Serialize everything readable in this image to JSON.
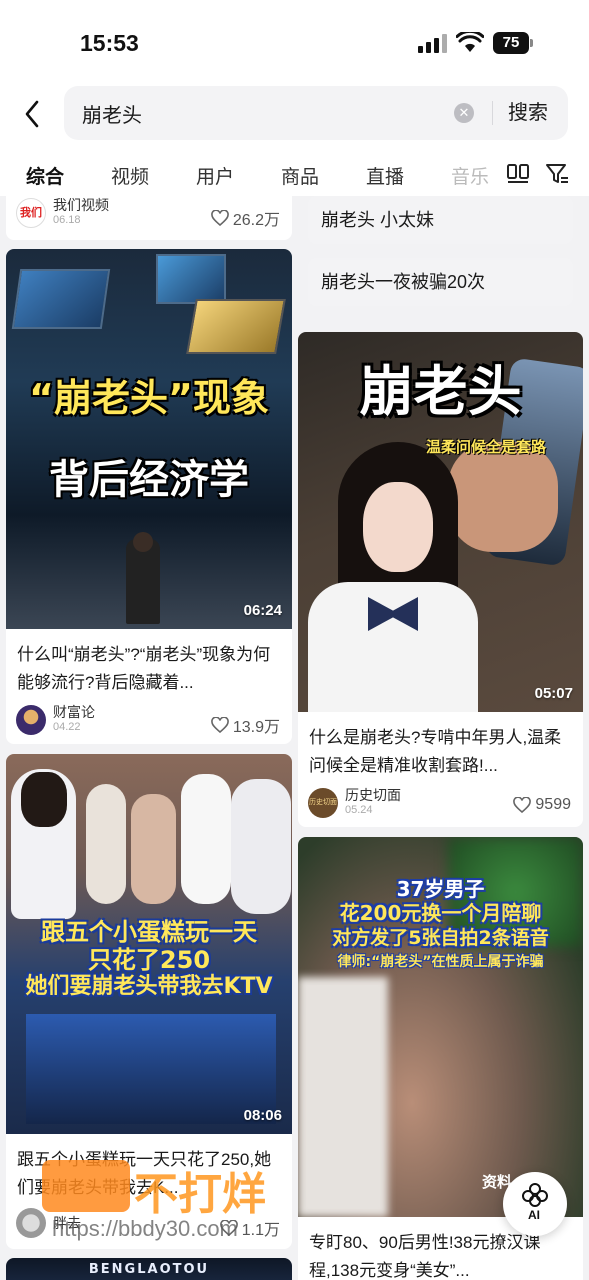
{
  "status_bar": {
    "time": "15:53",
    "battery": "75"
  },
  "search": {
    "query": "崩老头",
    "search_label": "搜索"
  },
  "tabs": [
    "综合",
    "视频",
    "用户",
    "商品",
    "直播",
    "音乐"
  ],
  "suggestions": [
    "崩老头 小太妹",
    "崩老头一夜被骗20次"
  ],
  "top_partial_card": {
    "author": "我们视频",
    "date": "06.18",
    "likes": "26.2万",
    "avatar_text": "我们"
  },
  "cards": [
    {
      "overlay_lines": [
        "“崩老头”现象",
        "背后经济学"
      ],
      "duration": "06:24",
      "title": "什么叫“崩老头”?“崩老头”现象为何能够流行?背后隐藏着...",
      "author": "财富论",
      "date": "04.22",
      "likes": "13.9万"
    },
    {
      "overlay_lines": [
        "崩老头",
        "温柔问候全是套路"
      ],
      "duration": "05:07",
      "title": "什么是崩老头?专啃中年男人,温柔问候全是精准收割套路!...",
      "author": "历史切面",
      "date": "05.24",
      "likes": "9599",
      "avatar_text": "历史切面"
    },
    {
      "overlay_lines": [
        "跟五个小蛋糕玩一天",
        "只花了250",
        "她们要崩老头带我去KTV"
      ],
      "duration": "08:06",
      "title": "跟五个小蛋糕玩一天只花了250,她们要崩老头带我去K...",
      "author": "胖去",
      "likes": "1.1万"
    },
    {
      "overlay_lines": [
        "37岁男子",
        "花200元换一个月陪聊",
        "对方发了5张自拍2条语音",
        "律师:“崩老头”在性质上属于诈骗"
      ],
      "corner_text": "资料",
      "title": "专盯80、90后男性!38元撩汉课程,138元变身“美女”..."
    },
    {
      "overlay_lines": [
        "BENGLAOTOU"
      ]
    }
  ],
  "watermark": {
    "brand": "不打烊",
    "url": "https://bbdy30.com"
  },
  "ai_button": "AI",
  "colors": {
    "accent_orange": "#ff8a1e",
    "overlay_yellow": "#ffe75a",
    "overlay_blue": "#2e63d6"
  }
}
